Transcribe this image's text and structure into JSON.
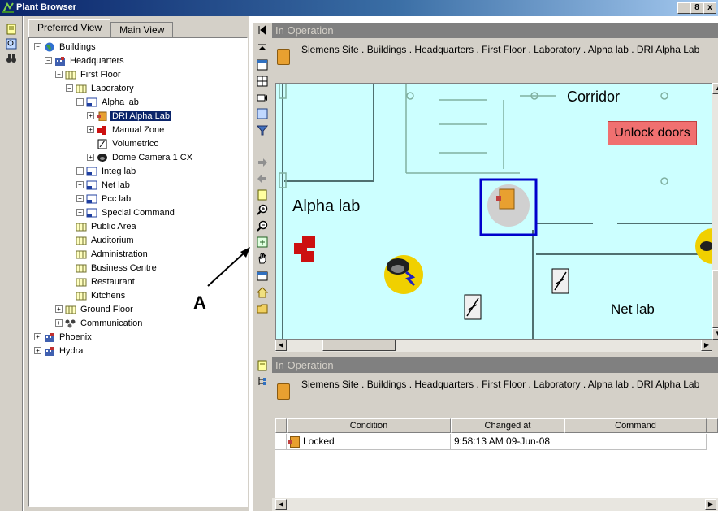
{
  "window": {
    "title": "Plant Browser",
    "buttons": [
      "_",
      "8",
      "x"
    ]
  },
  "tree": {
    "tabs": [
      "Preferred View",
      "Main View"
    ],
    "items": [
      {
        "label": "Buildings",
        "icon": "globe-icon",
        "exp": "−"
      },
      {
        "label": "Headquarters",
        "icon": "building-icon",
        "exp": "−"
      },
      {
        "label": "First Floor",
        "icon": "floor-icon",
        "exp": "−"
      },
      {
        "label": "Laboratory",
        "icon": "floor-icon",
        "exp": "−"
      },
      {
        "label": "Alpha lab",
        "icon": "room-icon",
        "exp": "−"
      },
      {
        "label": "DRI Alpha Lab",
        "icon": "door-icon",
        "exp": "+"
      },
      {
        "label": "Manual Zone",
        "icon": "zone-icon",
        "exp": "+"
      },
      {
        "label": "Volumetrico",
        "icon": "sensor-icon",
        "exp": ""
      },
      {
        "label": "Dome Camera 1 CX",
        "icon": "camera-icon",
        "exp": "+"
      },
      {
        "label": "Integ lab",
        "icon": "room-icon",
        "exp": "+"
      },
      {
        "label": "Net lab",
        "icon": "room-icon",
        "exp": "+"
      },
      {
        "label": "Pcc lab",
        "icon": "room-icon",
        "exp": "+"
      },
      {
        "label": "Special Command",
        "icon": "room-icon",
        "exp": "+"
      },
      {
        "label": "Public Area",
        "icon": "floor-icon",
        "exp": ""
      },
      {
        "label": "Auditorium",
        "icon": "floor-icon",
        "exp": ""
      },
      {
        "label": "Administration",
        "icon": "floor-icon",
        "exp": ""
      },
      {
        "label": "Business Centre",
        "icon": "floor-icon",
        "exp": ""
      },
      {
        "label": "Restaurant",
        "icon": "floor-icon",
        "exp": ""
      },
      {
        "label": "Kitchens",
        "icon": "floor-icon",
        "exp": ""
      },
      {
        "label": "Ground Floor",
        "icon": "floor-icon",
        "exp": "+"
      },
      {
        "label": "Communication",
        "icon": "network-icon",
        "exp": "+"
      },
      {
        "label": "Phoenix",
        "icon": "building-icon",
        "exp": "+"
      },
      {
        "label": "Hydra",
        "icon": "building-icon",
        "exp": "+"
      }
    ]
  },
  "top_pane": {
    "header": "In Operation",
    "path": "Siemens Site . Buildings . Headquarters . First Floor . Laboratory . Alpha lab . DRI Alpha Lab"
  },
  "map": {
    "labels": {
      "corridor": "Corridor",
      "alpha_lab": "Alpha lab",
      "net_lab": "Net lab"
    },
    "unlock_button": "Unlock doors"
  },
  "bottom_pane": {
    "header": "In Operation",
    "path": "Siemens Site . Buildings . Headquarters . First Floor . Laboratory . Alpha lab . DRI Alpha Lab",
    "columns": [
      "Condition",
      "Changed at",
      "Command"
    ],
    "rows": [
      {
        "condition": "Locked",
        "changed_at": "9:58:13 AM 09-Jun-08",
        "command": ""
      }
    ]
  },
  "annotation": "A",
  "colors": {
    "title_bar": "#0a246a",
    "map_bg": "#ccffff",
    "unlock_bg": "#f07070",
    "selection": "#0a246a",
    "door_highlight": "#0000cc"
  }
}
